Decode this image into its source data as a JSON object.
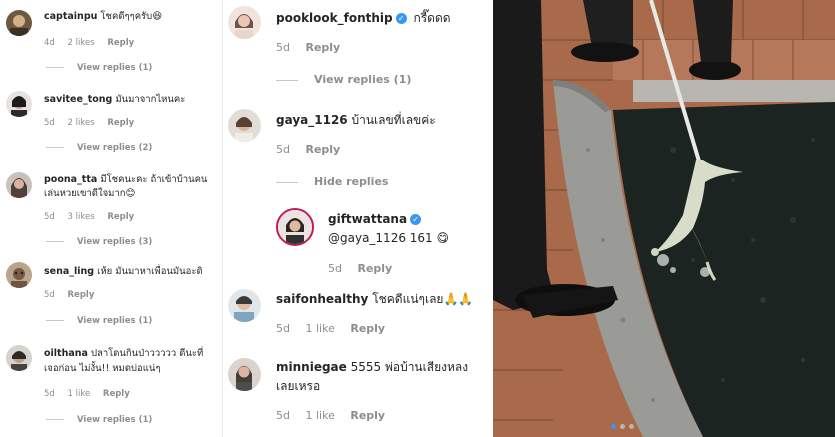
{
  "left_panel": {
    "comments": [
      {
        "user": "captainpu",
        "text": "โชคดีๆๆครับ😆",
        "age": "4d",
        "likes": "2 likes",
        "reply": "Reply",
        "view_replies": "View replies (1)"
      },
      {
        "user": "savitee_tong",
        "text": "มันมาจากไหนคะ",
        "age": "5d",
        "likes": "2 likes",
        "reply": "Reply",
        "view_replies": "View replies (2)"
      },
      {
        "user": "poona_tta",
        "text": "มีโชคนะคะ ถ้าเข้าบ้านคน",
        "text2": "เล่นหวยเขาดีใจมาก😊",
        "age": "5d",
        "likes": "3 likes",
        "reply": "Reply",
        "view_replies": "View replies (3)"
      },
      {
        "user": "sena_ling",
        "text": "เห้ย มันมาหาเพื่อนมันอะดิ",
        "age": "5d",
        "likes": "",
        "reply": "Reply",
        "view_replies": "View replies (1)"
      },
      {
        "user": "oilthana",
        "text": "ปลาโดนกินป่าววววว ดีนะที่",
        "text2": "เจอก่อน ไม่งั้น!! หมดบ่อแน่ๆ",
        "age": "5d",
        "likes": "1 like",
        "reply": "Reply",
        "view_replies": "View replies (1)"
      }
    ]
  },
  "middle_panel": {
    "comments": [
      {
        "user": "pooklook_fonthip",
        "text": "กรี๊ดดด",
        "age": "5d",
        "likes": "",
        "reply": "Reply",
        "view_replies": "View replies (1)",
        "verified": true
      },
      {
        "user": "gaya_1126",
        "text": "บ้านเลขที่เลขค่ะ",
        "age": "5d",
        "likes": "",
        "reply": "Reply",
        "view_replies": "Hide replies"
      },
      {
        "user": "giftwattana",
        "text": "@gaya_1126 161 😋",
        "age": "5d",
        "likes": "",
        "reply": "Reply",
        "verified": true
      },
      {
        "user": "saifonhealthy",
        "text": "โชคดีแน่ๆเลย🙏🙏",
        "age": "5d",
        "likes": "1 like",
        "reply": "Reply"
      },
      {
        "user": "minniegae",
        "text": "5555 พ่อบ้านเสียงหลง",
        "text2": "เลยเหรอ",
        "age": "5d",
        "likes": "1 like",
        "reply": "Reply"
      }
    ]
  },
  "colors": {
    "verified": "#3897f0",
    "meta_text": "#8e8e8e",
    "username": "#262626",
    "pond_water": "#1c2421",
    "deck_wood": "#a86a4a",
    "stone_rim": "#9a9a96"
  },
  "icons": {
    "verified": "verified-badge-icon",
    "carousel": "carousel-dots"
  }
}
